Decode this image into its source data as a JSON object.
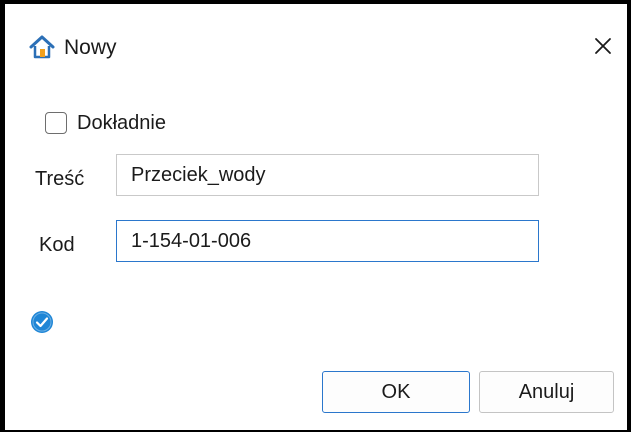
{
  "window": {
    "title": "Nowy",
    "icon": "house-icon",
    "close_icon": "close-icon"
  },
  "form": {
    "exact_checkbox": {
      "label": "Dokładnie",
      "checked": false
    },
    "content": {
      "label": "Treść",
      "value": "Przeciek_wody"
    },
    "code": {
      "label": "Kod",
      "value": "1-154-01-006"
    }
  },
  "status": {
    "icon": "check-circle-icon"
  },
  "buttons": {
    "ok": "OK",
    "cancel": "Anuluj"
  },
  "colors": {
    "accent": "#2b77cc",
    "status": "#1f86d6",
    "icon_roof": "#2b6fb6",
    "icon_door": "#f2a01c"
  }
}
